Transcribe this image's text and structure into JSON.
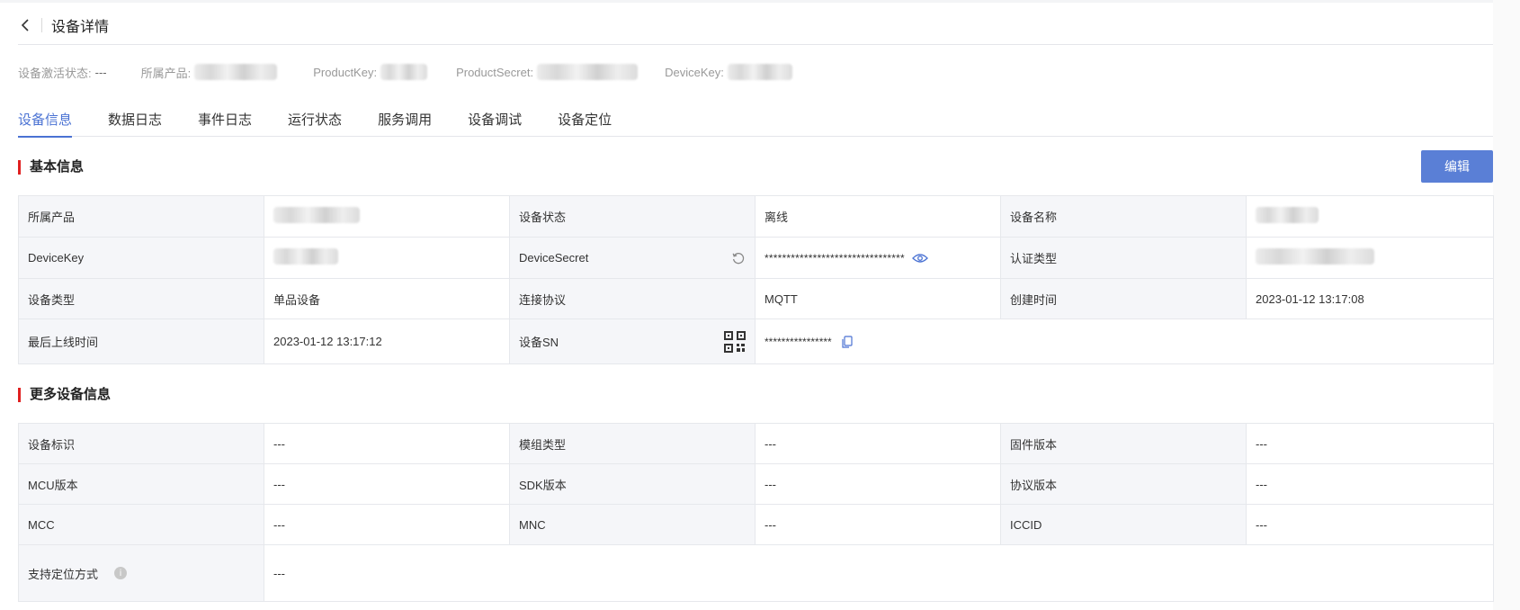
{
  "header": {
    "title": "设备详情"
  },
  "meta": {
    "activation_label": "设备激活状态:",
    "activation_value": "---",
    "product_label": "所属产品:",
    "product_key_label": "ProductKey:",
    "product_secret_label": "ProductSecret:",
    "device_key_label": "DeviceKey:"
  },
  "tabs": [
    "设备信息",
    "数据日志",
    "事件日志",
    "运行状态",
    "服务调用",
    "设备调试",
    "设备定位"
  ],
  "basic": {
    "title": "基本信息",
    "edit_label": "编辑",
    "product_label": "所属产品",
    "status_label": "设备状态",
    "status_value": "离线",
    "name_label": "设备名称",
    "device_key_label": "DeviceKey",
    "device_secret_label": "DeviceSecret",
    "device_secret_value": "********************************",
    "auth_type_label": "认证类型",
    "device_type_label": "设备类型",
    "device_type_value": "单品设备",
    "protocol_label": "连接协议",
    "protocol_value": "MQTT",
    "created_label": "创建时间",
    "created_value": "2023-01-12 13:17:08",
    "last_online_label": "最后上线时间",
    "last_online_value": "2023-01-12 13:17:12",
    "sn_label": "设备SN",
    "sn_value": "****************"
  },
  "more": {
    "title": "更多设备信息",
    "rows": [
      [
        {
          "label": "设备标识",
          "value": "---"
        },
        {
          "label": "模组类型",
          "value": "---"
        },
        {
          "label": "固件版本",
          "value": "---"
        }
      ],
      [
        {
          "label": "MCU版本",
          "value": "---"
        },
        {
          "label": "SDK版本",
          "value": "---"
        },
        {
          "label": "协议版本",
          "value": "---"
        }
      ],
      [
        {
          "label": "MCC",
          "value": "---"
        },
        {
          "label": "MNC",
          "value": "---"
        },
        {
          "label": "ICCID",
          "value": "---"
        }
      ]
    ],
    "positioning_label": "支持定位方式",
    "positioning_value": "---"
  },
  "colors": {
    "accent": "#4A72D3",
    "button": "#5A7FD6",
    "section_bar": "#e02020",
    "label_bg": "#f5f6f9"
  }
}
